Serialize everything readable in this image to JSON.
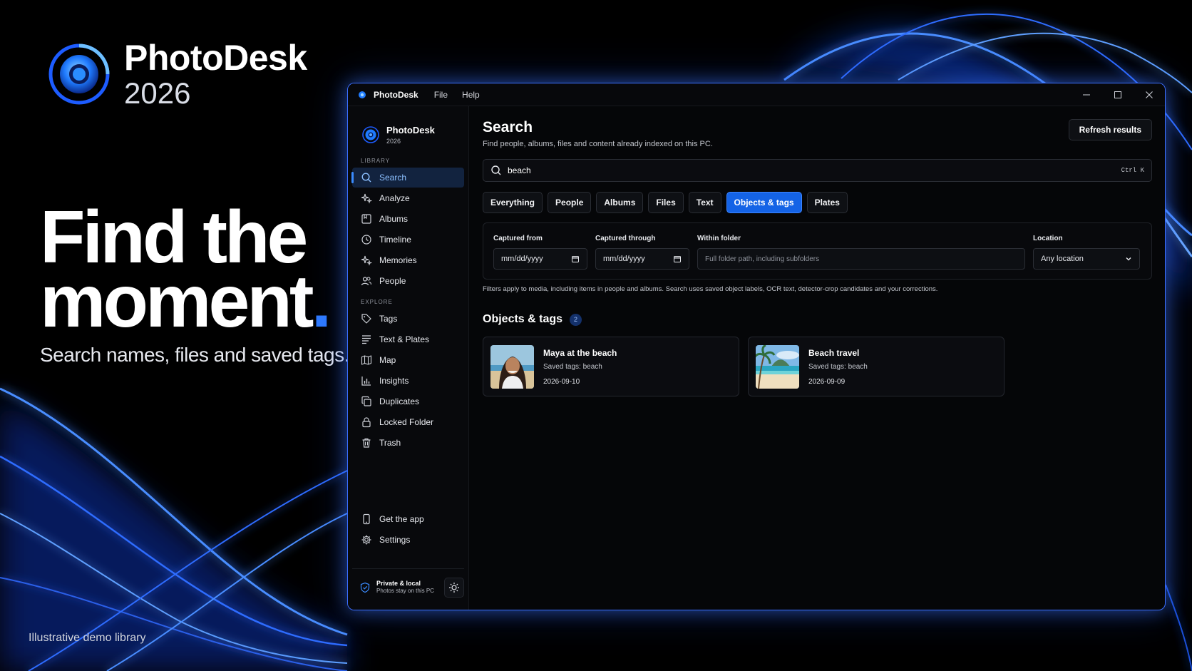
{
  "brand": {
    "name": "PhotoDesk",
    "year": "2026"
  },
  "hero": {
    "title_line1": "Find the",
    "title_line2": "moment",
    "title_dot": ".",
    "subtitle": "Search names, files and saved tags."
  },
  "footer_note": "Illustrative demo library",
  "window": {
    "title": "PhotoDesk",
    "menu": [
      "File",
      "Help"
    ]
  },
  "sidebar": {
    "brand_name": "PhotoDesk",
    "brand_year": "2026",
    "library_label": "LIBRARY",
    "library_items": [
      {
        "label": "Search",
        "icon": "search-icon",
        "active": true
      },
      {
        "label": "Analyze",
        "icon": "sparkle-icon"
      },
      {
        "label": "Albums",
        "icon": "album-icon"
      },
      {
        "label": "Timeline",
        "icon": "clock-icon"
      },
      {
        "label": "Memories",
        "icon": "sparkle-icon"
      },
      {
        "label": "People",
        "icon": "people-icon"
      }
    ],
    "explore_label": "EXPLORE",
    "explore_items": [
      {
        "label": "Tags",
        "icon": "tag-icon"
      },
      {
        "label": "Text & Plates",
        "icon": "text-icon"
      },
      {
        "label": "Map",
        "icon": "map-icon"
      },
      {
        "label": "Insights",
        "icon": "chart-icon"
      },
      {
        "label": "Duplicates",
        "icon": "duplicate-icon"
      },
      {
        "label": "Locked Folder",
        "icon": "lock-icon"
      },
      {
        "label": "Trash",
        "icon": "trash-icon"
      }
    ],
    "bottom_items": [
      {
        "label": "Get the app",
        "icon": "phone-icon"
      },
      {
        "label": "Settings",
        "icon": "gear-icon"
      }
    ],
    "privacy_title": "Private & local",
    "privacy_sub": "Photos stay on this PC"
  },
  "main": {
    "title": "Search",
    "subtitle": "Find people, albums, files and content already indexed on this PC.",
    "refresh_label": "Refresh results",
    "search_value": "beach",
    "search_shortcut": "Ctrl K",
    "tabs": [
      {
        "label": "Everything",
        "active": false
      },
      {
        "label": "People",
        "active": false
      },
      {
        "label": "Albums",
        "active": false
      },
      {
        "label": "Files",
        "active": false
      },
      {
        "label": "Text",
        "active": false
      },
      {
        "label": "Objects & tags",
        "active": true
      },
      {
        "label": "Plates",
        "active": false
      }
    ],
    "filters": {
      "captured_from_label": "Captured from",
      "captured_from_placeholder": "mm/dd/yyyy",
      "captured_through_label": "Captured through",
      "captured_through_placeholder": "mm/dd/yyyy",
      "folder_label": "Within folder",
      "folder_placeholder": "Full folder path, including subfolders",
      "location_label": "Location",
      "location_value": "Any location"
    },
    "filter_note": "Filters apply to media, including items in people and albums. Search uses saved object labels, OCR text, detector-crop candidates and your corrections.",
    "results_title": "Objects & tags",
    "results_count": "2",
    "results": [
      {
        "title": "Maya at the beach",
        "tags": "Saved tags: beach",
        "date": "2026-09-10"
      },
      {
        "title": "Beach travel",
        "tags": "Saved tags: beach",
        "date": "2026-09-09"
      }
    ]
  },
  "colors": {
    "accent": "#1463e6",
    "accent_light": "#3a8bff",
    "background": "#000000",
    "window_border": "#3b6eff"
  }
}
